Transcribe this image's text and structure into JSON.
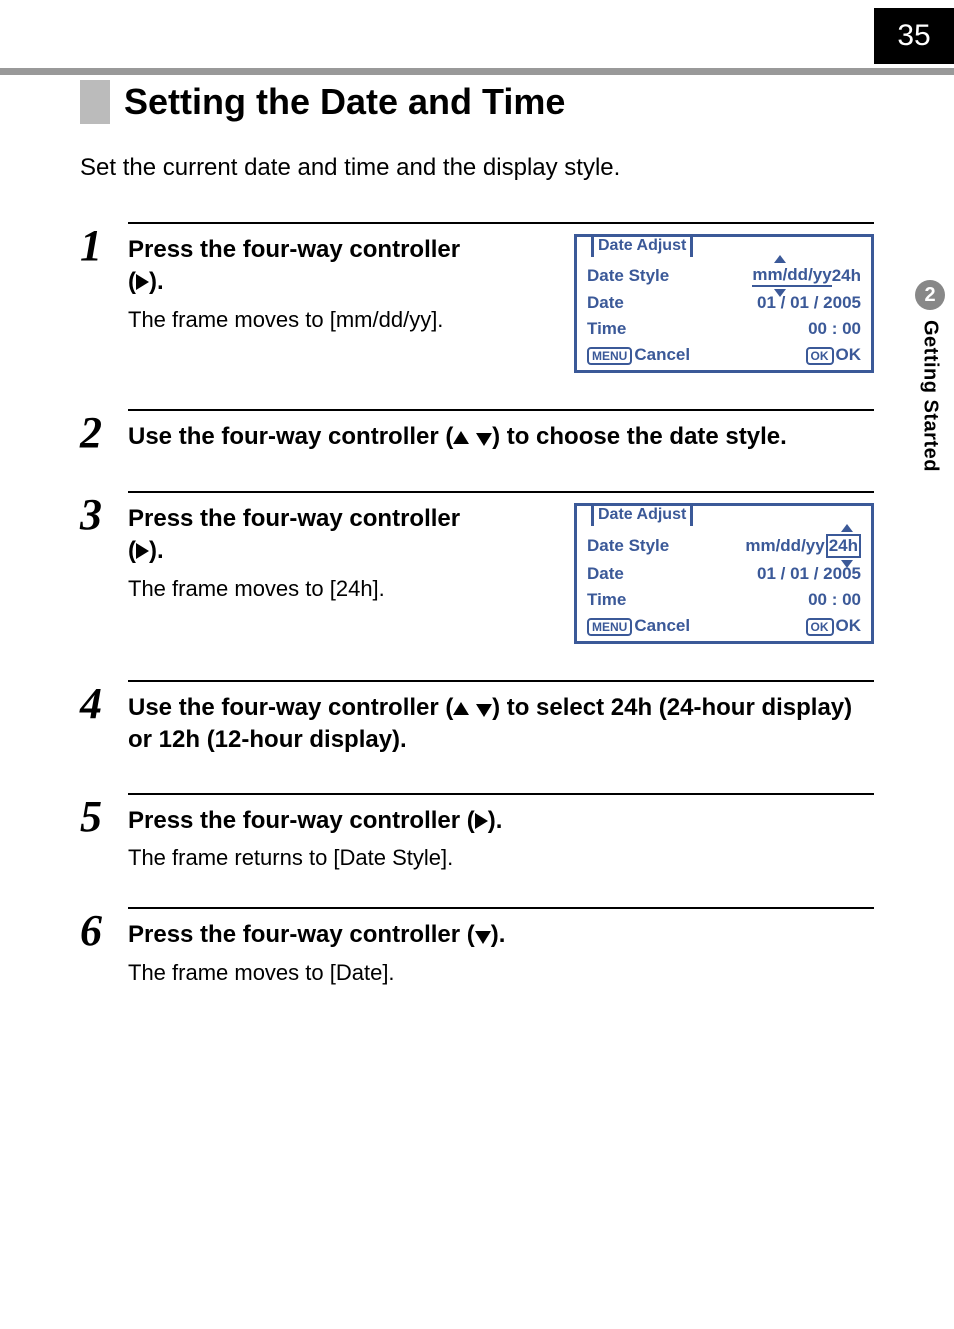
{
  "page_number": "35",
  "side_tab": {
    "number": "2",
    "label": "Getting Started"
  },
  "title": "Setting the Date and Time",
  "intro": "Set the current date and time and the display style.",
  "steps": {
    "s1": {
      "n": "1",
      "head_a": "Press the four-way controller",
      "head_b": "(",
      "head_c": ").",
      "desc": "The frame moves to [mm/dd/yy]."
    },
    "s2": {
      "n": "2",
      "head_a": "Use the four-way controller (",
      "head_b": ") to choose the date style."
    },
    "s3": {
      "n": "3",
      "head_a": "Press the four-way controller",
      "head_b": "(",
      "head_c": ").",
      "desc": "The frame moves to [24h]."
    },
    "s4": {
      "n": "4",
      "head_a": "Use the four-way controller (",
      "head_b": ") to select 24h (24-hour display) or 12h (12-hour display)."
    },
    "s5": {
      "n": "5",
      "head_a": "Press the four-way controller (",
      "head_b": ").",
      "desc": "The frame returns to [Date Style]."
    },
    "s6": {
      "n": "6",
      "head_a": "Press the four-way controller (",
      "head_b": ").",
      "desc": "The frame moves to [Date]."
    }
  },
  "lcd": {
    "title": "Date Adjust",
    "dateStyleLabel": "Date Style",
    "formatText": "mm/dd/yy",
    "hourText": "24h",
    "dateLabel": "Date",
    "dateValue": "01 / 01 / 2005",
    "timeLabel": "Time",
    "timeValue": "00 : 00",
    "menuPill": "MENU",
    "cancel": "Cancel",
    "okPill": "OK",
    "ok": "OK"
  }
}
